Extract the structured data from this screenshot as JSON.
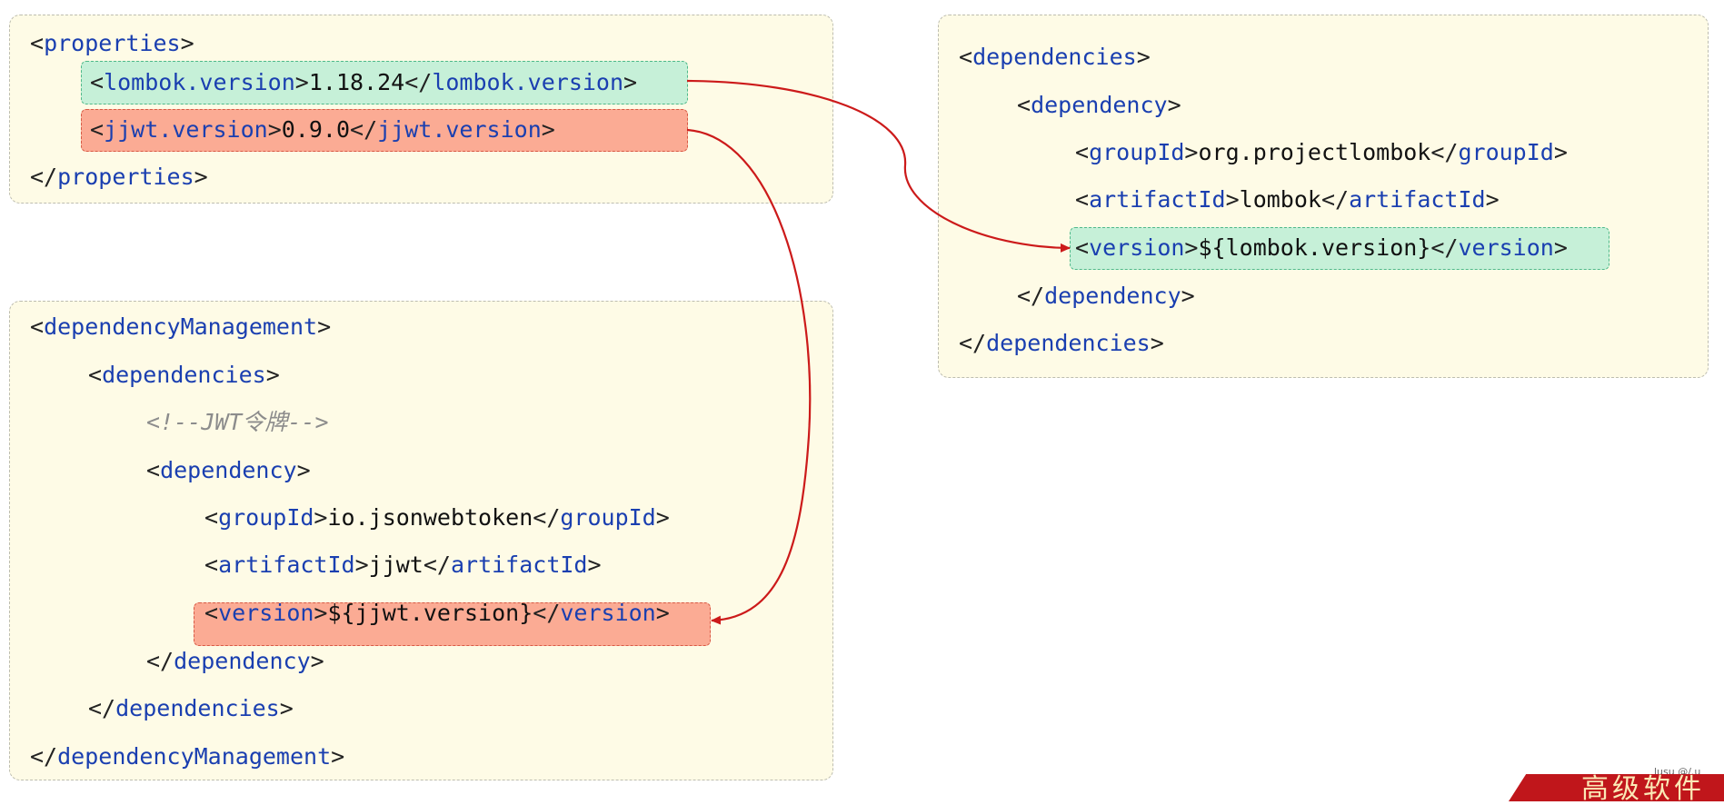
{
  "properties_block": {
    "open": {
      "b1": "<",
      "tag": "properties",
      "b2": ">"
    },
    "lombok_line": {
      "b1": "<",
      "tag1": "lombok.version",
      "b2": ">",
      "value": "1.18.24",
      "b3": "</",
      "tag2": "lombok.version",
      "b4": ">"
    },
    "jjwt_line": {
      "b1": "<",
      "tag1": "jjwt.version",
      "b2": ">",
      "value": "0.9.0",
      "b3": "</",
      "tag2": "jjwt.version",
      "b4": ">"
    },
    "close": {
      "b1": "</",
      "tag": "properties",
      "b2": ">"
    }
  },
  "dependencies_block": {
    "deps_open": {
      "b1": "<",
      "tag": "dependencies",
      "b2": ">"
    },
    "dep_open": {
      "b1": "<",
      "tag": "dependency",
      "b2": ">"
    },
    "group_line": {
      "b1": "<",
      "tag1": "groupId",
      "b2": ">",
      "value": "org.projectlombok",
      "b3": "</",
      "tag2": "groupId",
      "b4": ">"
    },
    "artifact_line": {
      "b1": "<",
      "tag1": "artifactId",
      "b2": ">",
      "value": "lombok",
      "b3": "</",
      "tag2": "artifactId",
      "b4": ">"
    },
    "version_line": {
      "b1": "<",
      "tag1": "version",
      "b2": ">",
      "value": "${lombok.version}",
      "b3": "</",
      "tag2": "version",
      "b4": ">"
    },
    "dep_close": {
      "b1": "</",
      "tag": "dependency",
      "b2": ">"
    },
    "deps_close": {
      "b1": "</",
      "tag": "dependencies",
      "b2": ">"
    }
  },
  "management_block": {
    "mgmt_open": {
      "b1": "<",
      "tag": "dependencyManagement",
      "b2": ">"
    },
    "deps_open": {
      "b1": "<",
      "tag": "dependencies",
      "b2": ">"
    },
    "comment": "<!--JWT令牌-->",
    "dep_open": {
      "b1": "<",
      "tag": "dependency",
      "b2": ">"
    },
    "group_line": {
      "b1": "<",
      "tag1": "groupId",
      "b2": ">",
      "value": "io.jsonwebtoken",
      "b3": "</",
      "tag2": "groupId",
      "b4": ">"
    },
    "artifact_line": {
      "b1": "<",
      "tag1": "artifactId",
      "b2": ">",
      "value": "jjwt",
      "b3": "</",
      "tag2": "artifactId",
      "b4": ">"
    },
    "version_line": {
      "b1": "<",
      "tag1": "version",
      "b2": ">",
      "value": "${jjwt.version}",
      "b3": "</",
      "tag2": "version",
      "b4": ">"
    },
    "dep_close": {
      "b1": "</",
      "tag": "dependency",
      "b2": ">"
    },
    "deps_close": {
      "b1": "</",
      "tag": "dependencies",
      "b2": ">"
    },
    "mgmt_close": {
      "b1": "</",
      "tag": "dependencyManagement",
      "b2": ">"
    }
  },
  "corner_badge": {
    "text": "高级软件",
    "watermark": "lusu @/.u"
  },
  "colors": {
    "panel_bg": "#fefbe6",
    "tag_blue": "#1a3fb0",
    "highlight_green": "#c6f0d8",
    "highlight_red": "#fbab94",
    "arrow_red": "#cc1a1a"
  }
}
